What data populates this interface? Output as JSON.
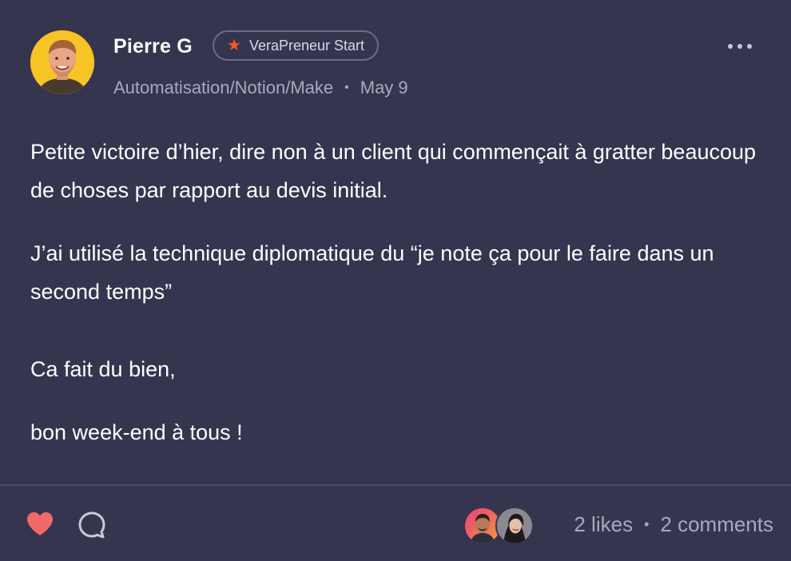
{
  "author": {
    "name": "Pierre G",
    "badge": "VeraPreneur Start",
    "category": "Automatisation/Notion/Make",
    "date": "May 9"
  },
  "content": {
    "paragraphs": [
      "Petite victoire d’hier, dire non à un client qui commençait à gratter beaucoup de choses par rapport au devis initial.",
      "J’ai utilisé la technique diplomatique du “je note ça pour le faire dans un second temps”",
      "Ca fait du bien,",
      "bon week-end à tous !"
    ]
  },
  "footer": {
    "likes": "2 likes",
    "comments": "2 comments"
  },
  "icons": {
    "badge": "star-icon",
    "more": "more-horizontal-icon",
    "like": "heart-icon",
    "comment": "comment-bubble-icon"
  },
  "colors": {
    "background": "#363550",
    "like_heart": "#f06a6a",
    "badge_star": "#f55a1f",
    "avatar_bg": "#f7c325",
    "muted_text": "#a9a8bd"
  }
}
